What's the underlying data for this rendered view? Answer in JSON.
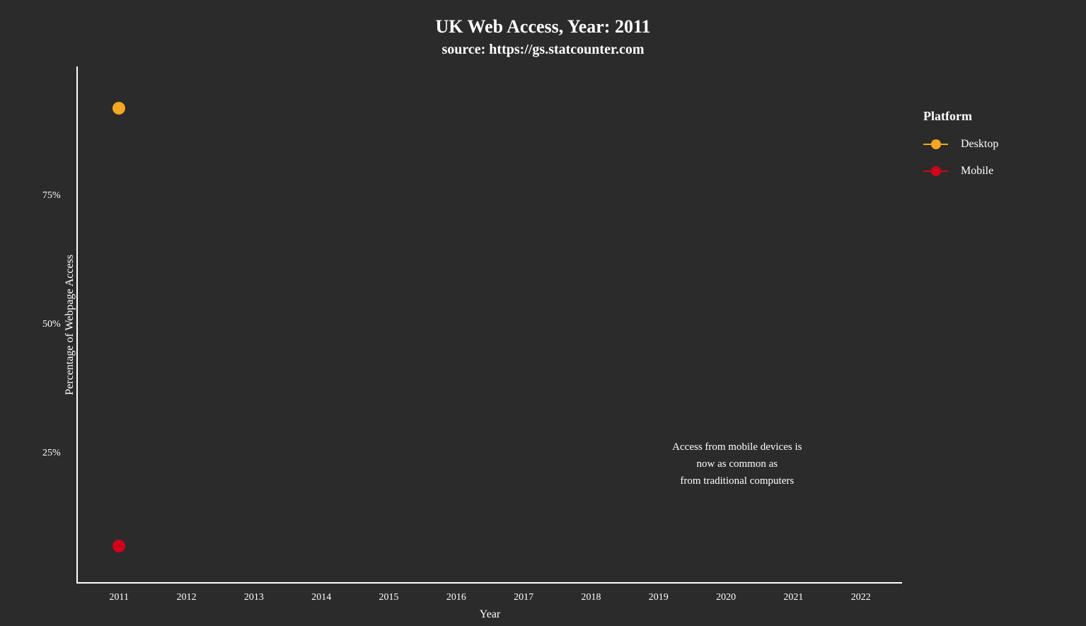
{
  "chart": {
    "title_main": "UK Web Access, Year: 2011",
    "title_sub": "source: https://gs.statcounter.com",
    "y_axis_label": "Percentage of Webpage Access",
    "x_axis_label": "Year",
    "y_ticks": [
      "75%",
      "50%",
      "25%"
    ],
    "x_ticks": [
      "2011",
      "2012",
      "2013",
      "2014",
      "2015",
      "2016",
      "2017",
      "2018",
      "2019",
      "2020",
      "2021",
      "2022"
    ],
    "annotation": "Access from mobile devices is\nnow as common as\nfrom traditional computers",
    "data_points": {
      "desktop_2011_pct": 92,
      "mobile_2011_pct": 7
    },
    "legend": {
      "title": "Platform",
      "items": [
        {
          "label": "Desktop",
          "color": "#f5a623"
        },
        {
          "label": "Mobile",
          "color": "#d0021b"
        }
      ]
    }
  }
}
